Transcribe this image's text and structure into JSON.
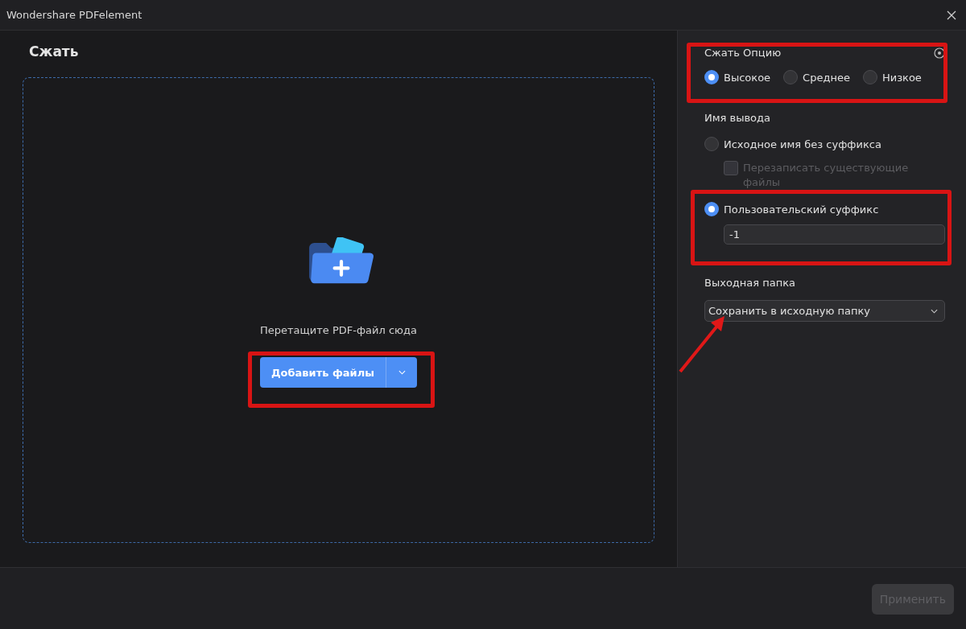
{
  "window": {
    "title": "Wondershare PDFelement"
  },
  "page_title": "Сжать",
  "dropzone": {
    "hint": "Перетащите PDF-файл сюда",
    "add_button": "Добавить файлы"
  },
  "compress": {
    "label": "Сжать Опцию",
    "choices": [
      {
        "label": "Высокое",
        "selected": true
      },
      {
        "label": "Среднее",
        "selected": false
      },
      {
        "label": "Низкое",
        "selected": false
      }
    ]
  },
  "output_name": {
    "label": "Имя вывода",
    "choices": [
      {
        "label": "Исходное имя без суффикса",
        "selected": false
      },
      {
        "label": "Пользовательский суффикс",
        "selected": true
      }
    ],
    "overwrite": {
      "label": "Перезаписать существующие файлы",
      "checked": false,
      "disabled": true
    },
    "suffix_value": "-1"
  },
  "output_folder": {
    "label": "Выходная папка",
    "value": "Сохранить в исходную папку"
  },
  "apply_button": {
    "label": "Применить",
    "disabled": true
  }
}
